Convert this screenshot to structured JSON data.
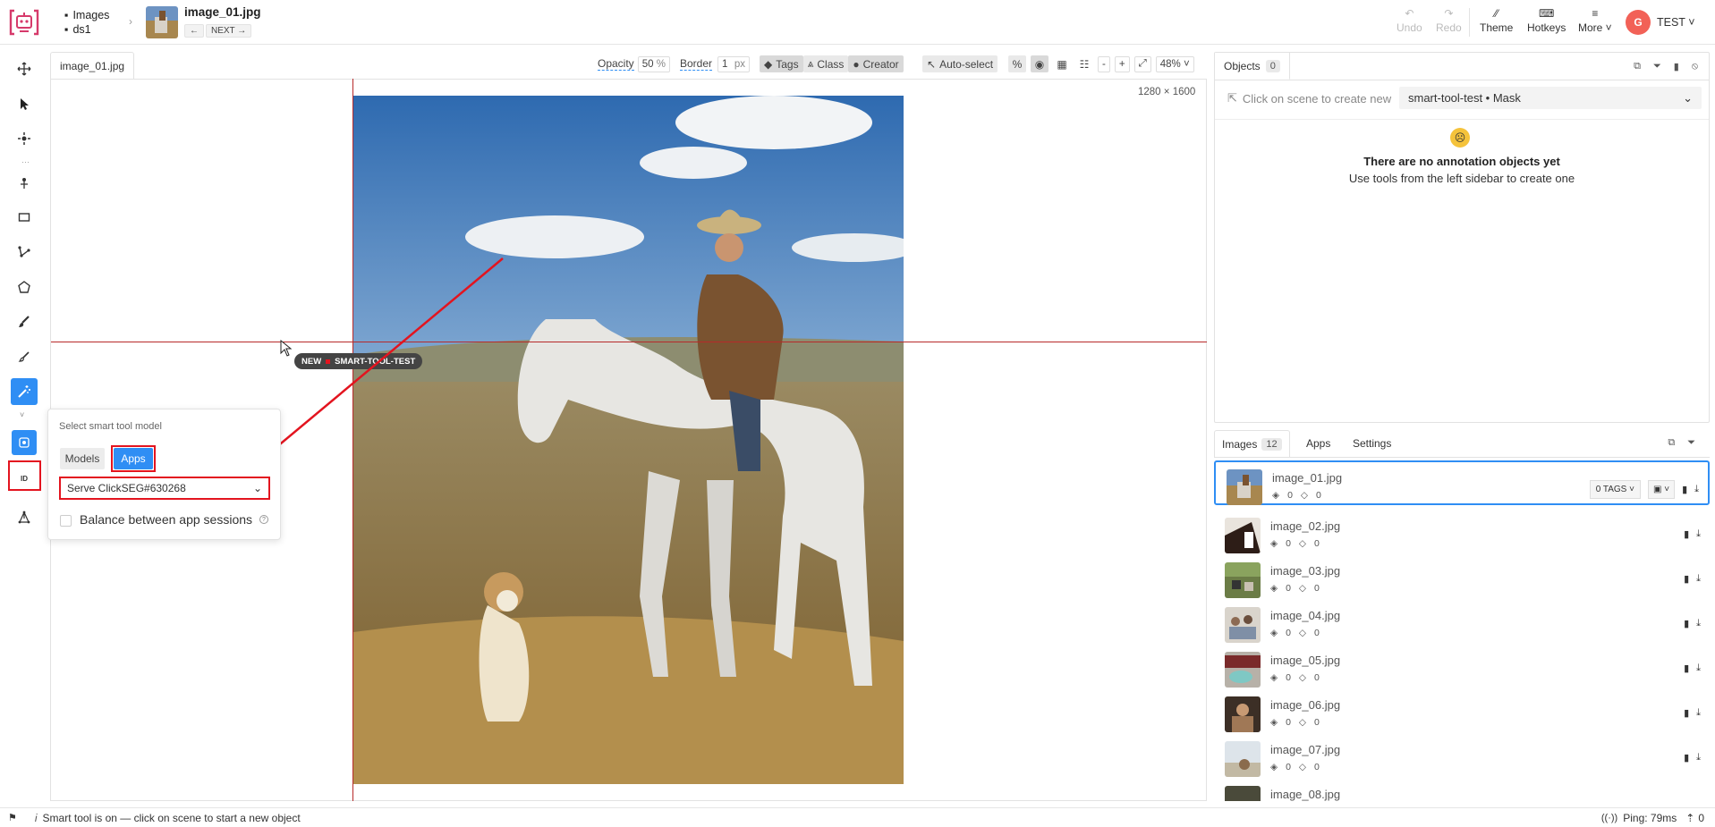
{
  "header": {
    "breadcrumb_project": "Images",
    "breadcrumb_dataset": "ds1",
    "file_name": "image_01.jpg",
    "prev_label": "←",
    "next_label": "NEXT →",
    "undo_label": "Undo",
    "redo_label": "Redo",
    "theme_label": "Theme",
    "hotkeys_label": "Hotkeys",
    "more_label": "More",
    "avatar_initial": "G",
    "user_name": "TEST"
  },
  "canvas": {
    "tab_label": "image_01.jpg",
    "opacity_label": "Opacity",
    "opacity_value": "50",
    "opacity_unit": "%",
    "border_label": "Border",
    "border_value": "1",
    "border_unit": "px",
    "tags_label": "Tags",
    "class_label": "Class",
    "creator_label": "Creator",
    "autoselect_label": "Auto-select",
    "zoom_minus": "-",
    "zoom_plus": "+",
    "zoom_value": "48%",
    "image_dims": "1280 × 1600",
    "cursor_tag_new": "NEW",
    "cursor_tag_name": "SMART-TOOL-TEST"
  },
  "smart_tool_popup": {
    "title": "Select smart tool model",
    "tab_models": "Models",
    "tab_apps": "Apps",
    "selected_app": "Serve ClickSEG#630268",
    "balance_label": "Balance between app sessions",
    "help_mark": "?"
  },
  "objects_panel": {
    "title": "Objects",
    "count": "0",
    "hint": "Click on scene to create new",
    "class_select": "smart-tool-test • Mask",
    "empty_title": "There are no annotation objects yet",
    "empty_sub": "Use tools from the left sidebar to create one"
  },
  "images_panel": {
    "tab_images": "Images",
    "images_count": "12",
    "tab_apps": "Apps",
    "tab_settings": "Settings",
    "tags_button": "0 TAGS",
    "items": [
      {
        "name": "image_01.jpg",
        "objects": "0",
        "tags": "0"
      },
      {
        "name": "image_02.jpg",
        "objects": "0",
        "tags": "0"
      },
      {
        "name": "image_03.jpg",
        "objects": "0",
        "tags": "0"
      },
      {
        "name": "image_04.jpg",
        "objects": "0",
        "tags": "0"
      },
      {
        "name": "image_05.jpg",
        "objects": "0",
        "tags": "0"
      },
      {
        "name": "image_06.jpg",
        "objects": "0",
        "tags": "0"
      },
      {
        "name": "image_07.jpg",
        "objects": "0",
        "tags": "0"
      },
      {
        "name": "image_08.jpg",
        "objects": "",
        "tags": ""
      }
    ]
  },
  "status_bar": {
    "message": "Smart tool is on — click on scene to start a new object",
    "ping": "Ping: 79ms",
    "uploads": "0"
  },
  "colors": {
    "accent": "#2f8ef4",
    "highlight": "#e3141f",
    "crosshair": "#b72a2a",
    "avatar": "#f26157"
  }
}
